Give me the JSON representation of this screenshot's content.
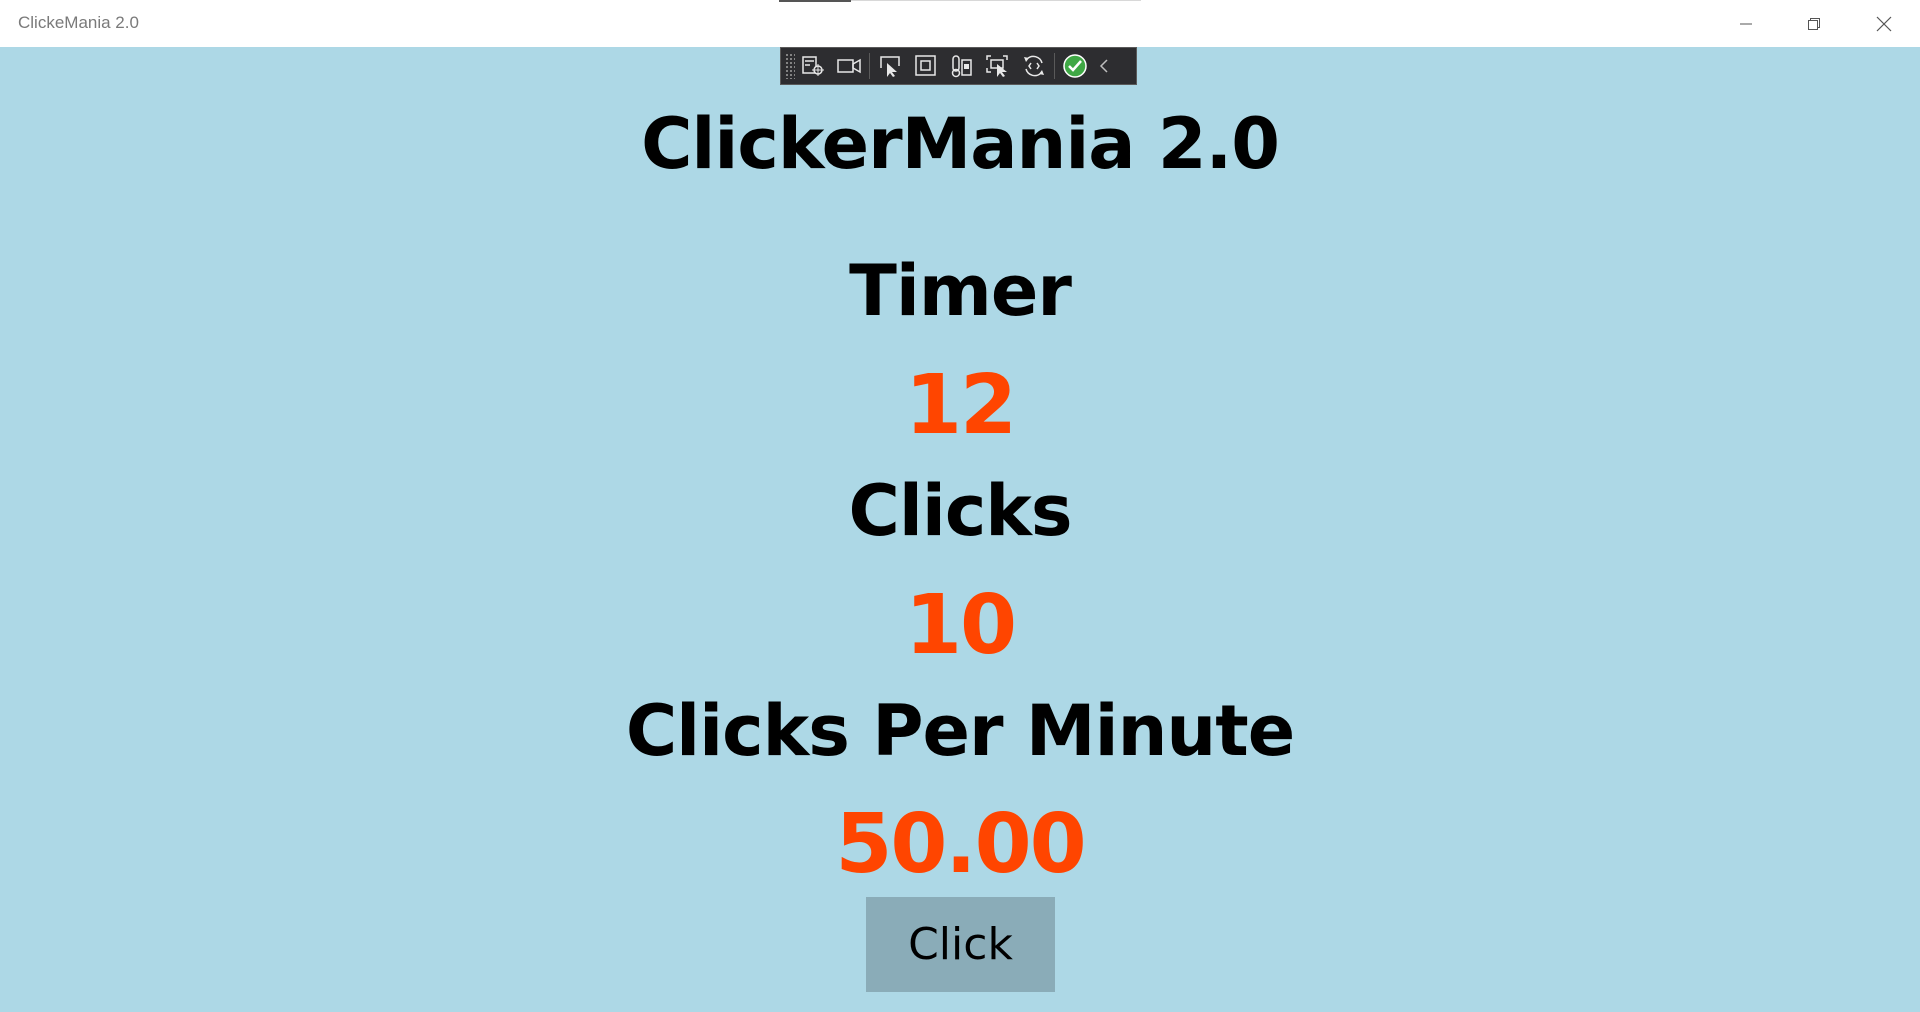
{
  "window": {
    "title": "ClickeMania 2.0"
  },
  "debug_toolbar": {
    "items": [
      {
        "icon": "live-visual-tree-icon"
      },
      {
        "icon": "record-video-icon"
      },
      {
        "icon": "select-element-icon"
      },
      {
        "icon": "display-layout-adorners-icon"
      },
      {
        "icon": "track-focus-icon"
      },
      {
        "icon": "preview-selection-icon"
      },
      {
        "icon": "hot-reload-icon"
      },
      {
        "icon": "accessibility-check-icon"
      },
      {
        "icon": "collapse-toolbar-icon"
      }
    ]
  },
  "main": {
    "app_title": "ClickerMania 2.0",
    "timer_label": "Timer",
    "timer_value": "12",
    "clicks_label": "Clicks",
    "clicks_value": "10",
    "cpm_label": "Clicks Per Minute",
    "cpm_value": "50.00",
    "click_button_label": "Click"
  },
  "colors": {
    "background": "#add8e6",
    "value_accent": "#ff4500",
    "button_bg": "#8aacb8"
  }
}
